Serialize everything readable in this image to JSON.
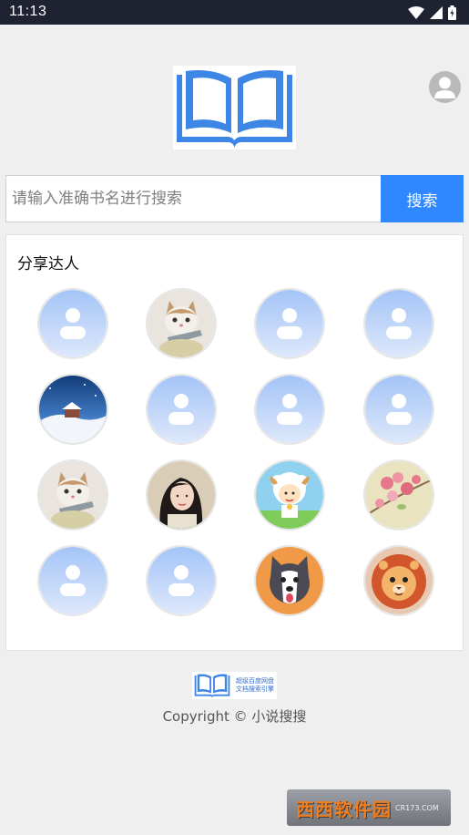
{
  "status_bar": {
    "time": "11:13"
  },
  "search": {
    "placeholder": "请输入准确书名进行搜索",
    "button_label": "搜索"
  },
  "share_section": {
    "title": "分享达人",
    "avatars": [
      {
        "type": "default"
      },
      {
        "type": "cat"
      },
      {
        "type": "default"
      },
      {
        "type": "default"
      },
      {
        "type": "snow"
      },
      {
        "type": "default"
      },
      {
        "type": "default"
      },
      {
        "type": "default"
      },
      {
        "type": "cat"
      },
      {
        "type": "girl"
      },
      {
        "type": "sheep"
      },
      {
        "type": "flower"
      },
      {
        "type": "default"
      },
      {
        "type": "default"
      },
      {
        "type": "husky"
      },
      {
        "type": "lion"
      }
    ]
  },
  "footer": {
    "logo_caption_1": "超级百度网盘",
    "logo_caption_2": "文档搜索引擎",
    "copyright": "Copyright © 小说搜搜"
  },
  "watermark": {
    "text": "西西软件园",
    "sub": "CR173.COM"
  },
  "colors": {
    "accent": "#2f88ff",
    "status_bar": "#1f2331",
    "logo_blue": "#3d86e6"
  }
}
